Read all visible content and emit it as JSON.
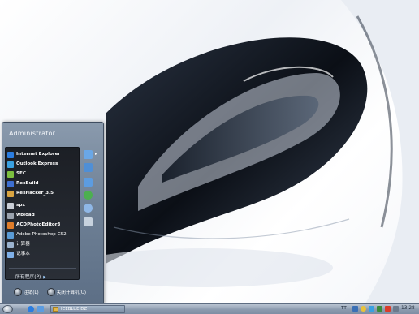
{
  "start_menu": {
    "user": "Administrator",
    "pinned_programs": [
      {
        "label": "Internet Explorer",
        "icon": "internet-explorer-icon",
        "color": "#2b7de0"
      },
      {
        "label": "Outlook Express",
        "icon": "outlook-express-icon",
        "color": "#3aa0e0"
      },
      {
        "label": "SFC",
        "icon": "sfc-icon",
        "color": "#7cbf3f"
      },
      {
        "label": "ResBuild",
        "icon": "resbuild-icon",
        "color": "#3d6fd1"
      },
      {
        "label": "ResHacker_3.5",
        "icon": "reshacker-icon",
        "color": "#d9a441"
      }
    ],
    "recent_programs": [
      {
        "label": "spx",
        "icon": "spx-icon",
        "color": "#c9ced6"
      },
      {
        "label": "wbload",
        "icon": "wbload-icon",
        "color": "#9aa2ad"
      },
      {
        "label": "ACDPhotoEditor3",
        "icon": "acdphotoeditor-icon",
        "color": "#e07d2a"
      },
      {
        "label": "Adobe Photoshop CS2",
        "icon": "photoshop-icon",
        "color": "#5a9bd5"
      },
      {
        "label": "计算器",
        "icon": "calculator-icon",
        "color": "#9bb3cf"
      },
      {
        "label": "记事本",
        "icon": "notepad-icon",
        "color": "#7fb0e8"
      }
    ],
    "all_programs": "所有程序(P)",
    "logoff": "注销(L)",
    "shutdown": "关闭计算机(U)",
    "right_icons": [
      {
        "icon": "my-documents-icon",
        "color": "#6aa7e6"
      },
      {
        "icon": "my-computer-icon",
        "color": "#4f8fd6"
      },
      {
        "icon": "control-panel-icon",
        "color": "#5c9ce0"
      },
      {
        "icon": "network-icon",
        "color": "#4caf50"
      },
      {
        "icon": "search-icon",
        "color": "#8fb7e6"
      },
      {
        "icon": "run-icon",
        "color": "#c7d2de"
      }
    ]
  },
  "taskbar": {
    "quick_launch": [
      {
        "icon": "ie-quicklaunch-icon",
        "color": "#2b7de0"
      },
      {
        "icon": "show-desktop-icon",
        "color": "#5c9ce0"
      }
    ],
    "active_task": "ICEBLUE DZ",
    "language": "TT",
    "tray_icons": [
      {
        "icon": "tray-icon-1",
        "color": "#3a6fb5"
      },
      {
        "icon": "tray-icon-2",
        "color": "#e8c23a"
      },
      {
        "icon": "tray-icon-3",
        "color": "#3aa0e0"
      },
      {
        "icon": "tray-icon-4",
        "color": "#3a8a3a"
      },
      {
        "icon": "tray-icon-5",
        "color": "#d93c2b"
      },
      {
        "icon": "tray-icon-6",
        "color": "#6c7a8c"
      }
    ],
    "clock": "13:28"
  }
}
